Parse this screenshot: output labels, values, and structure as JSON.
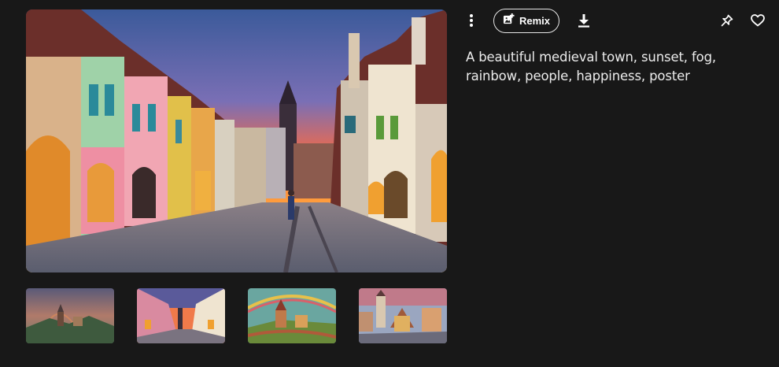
{
  "gallery": {
    "main_image_alt": "",
    "thumbnails": [
      {
        "name": "thumbnail-1"
      },
      {
        "name": "thumbnail-2"
      },
      {
        "name": "thumbnail-3"
      },
      {
        "name": "thumbnail-4"
      }
    ]
  },
  "toolbar": {
    "more_icon": "more-vertical-icon",
    "remix_icon": "image-plus-icon",
    "remix_label": "Remix",
    "download_icon": "download-icon",
    "pin_icon": "pin-icon",
    "favorite_icon": "heart-icon"
  },
  "prompt": {
    "text": "A beautiful medieval town, sunset, fog, rainbow, people, happiness, poster"
  },
  "colors": {
    "background": "#181818",
    "text": "#ececec",
    "accent_border": "#e6e6e6"
  }
}
